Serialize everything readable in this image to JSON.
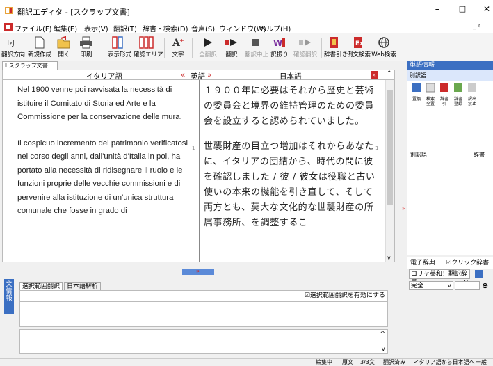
{
  "window": {
    "title": "翻訳エディタ - [スクラップ文書]",
    "controls": {
      "minimize": "–",
      "maximize": "□",
      "close": "✕"
    }
  },
  "menu": [
    "ファイル(F)",
    "編集(E)",
    "表示(V)",
    "翻訳(T)",
    "辞書・検索(D)",
    "音声(S)",
    "ウィンドウ(W)",
    "ヘルプ(H)"
  ],
  "menu_right": "_ ♯",
  "toolbar": {
    "direction": "翻訳方向",
    "new": "新規作成",
    "open": "開く",
    "print": "印刷",
    "view_format": "表示形式",
    "confirm_area": "確認エリア",
    "text": "文字",
    "translate_all": "全翻訳",
    "translate": "翻訳",
    "stop": "翻訳中止",
    "alternative": "訳振り",
    "confirm_translate": "確認翻訳",
    "dict_lookup": "辞書引き",
    "example_search": "例文検索",
    "web_search": "Web検索"
  },
  "document_tab": "スクラップ文書",
  "columns": {
    "left": "イタリア語",
    "center_left": "«",
    "center": "英語",
    "center_right": "»",
    "right": "日本語"
  },
  "italian": [
    "Nel 1900 venne poi ravvisata la necessità di istituire il Comitato di Storia ed Arte e la Commissione per la conservazione delle mura.",
    "Il cospicuo incremento del patrimonio verificatosi nel corso degli anni, dall'unità d'Italia in poi, ha portato alla necessità di ridisegnare il ruolo e le funzioni proprie delle vecchie commissioni e di pervenire alla istituzione di un'unica struttura comunale che fosse in grado di"
  ],
  "japanese": [
    "１９００年に必要はそれから歴史と芸術の委員会と境界の維持管理のための委員会を設立すると認められていました。",
    "世襲財産の目立つ増加はそれからあなたに、イタリアの団結から、時代の間に彼を確認しました / 彼 / 彼女は役職と古い使いの本来の機能を引き直して、そして両方とも、莫大な文化的な世襲財産の所属事務所、を調整するこ"
  ],
  "segment_number": "1",
  "bottom": {
    "side_label": "文情報",
    "tab_selected": "選択範囲翻訳",
    "tab_other": "日本語解析",
    "checkbox_label": "☑選択範囲翻訳を有効にする"
  },
  "right": {
    "header": "単語情報",
    "subheader": "別訳語",
    "tools": [
      "置換",
      "検索全置",
      "辞書引",
      "辞書登録",
      "訳出禁止"
    ],
    "alt_word_col": "別訳語",
    "dict_col": "辞書",
    "edict_label": "電子辞典",
    "click_dict": "☑クリック辞書引",
    "dict_select": "コリャ英和！翻訳辞書",
    "match_select": "完全"
  },
  "status": {
    "editing": "編集中",
    "text_label": "原文",
    "count": "3/3文",
    "state": "翻訳済み",
    "direction": "イタリア語から日本語へ",
    "mode": "一般"
  },
  "colors": {
    "accent": "#3b6fc2",
    "panel_bg": "#f0f0f0",
    "text": "#222222",
    "red": "#cc2b2b"
  }
}
